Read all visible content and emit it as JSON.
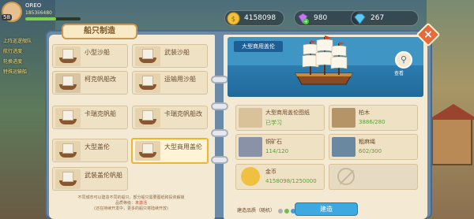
{
  "player": {
    "level": "58",
    "name": "OREO",
    "id": "1853ii6480"
  },
  "side_labels": [
    "上阵巡逻舰队",
    "航行进度",
    "轮换进度",
    "特殊运输船"
  ],
  "currency": {
    "gold": {
      "value": "4158098",
      "icon": "gold-coin-icon"
    },
    "gem": {
      "value": "980",
      "icon": "purple-gem-icon"
    },
    "diamond": {
      "value": "267",
      "icon": "blue-diamond-icon"
    }
  },
  "panel": {
    "title": "船只制造",
    "close_label": "×"
  },
  "ships": [
    {
      "label": "小型沙船"
    },
    {
      "label": "武装沙船"
    },
    {
      "label": "柯克帆船改"
    },
    {
      "label": "运输用沙船"
    },
    {
      "label": "卡瑞克帆船"
    },
    {
      "label": "卡瑞克帆船改"
    },
    {
      "label": "大型盖伦"
    },
    {
      "label": "大型商用盖伦"
    },
    {
      "label": "武装盖伦帆船"
    }
  ],
  "left_note": {
    "line1_a": "不同城市可以建造不同的船只，部分船只需要图纸和投资解锁",
    "line2_a": "品质等级：",
    "line2_red": "未激活",
    "line3": "(还在持续开发中，更多的船只将陆续开放)"
  },
  "detail": {
    "ship_name": "大型商用盖伦",
    "view_label": "查看",
    "view_icon": "magnifier-icon"
  },
  "materials": [
    {
      "name": "大型商用盖伦图纸",
      "qty": "已学习",
      "icon": "blueprint-icon"
    },
    {
      "name": "柏木",
      "qty": "3886/280",
      "icon": "wood-log-icon"
    },
    {
      "name": "铜矿石",
      "qty": "114/120",
      "icon": "copper-ore-icon"
    },
    {
      "name": "粗麻绳",
      "qty": "602/300",
      "icon": "rope-icon"
    },
    {
      "name": "金币",
      "qty": "4158098/1250000",
      "icon": "gold-coin-icon"
    }
  ],
  "quality": {
    "label": "建造品质（随机）",
    "colors": [
      "#b0b0b0",
      "#6ac04a",
      "#4a9ae0",
      "#a060e0",
      "#f0a030"
    ]
  },
  "build_button": {
    "label": "建造"
  },
  "colors": {
    "accent": "#3ea8e0",
    "banner": "#3f95c4",
    "selected": "#f2b430"
  }
}
